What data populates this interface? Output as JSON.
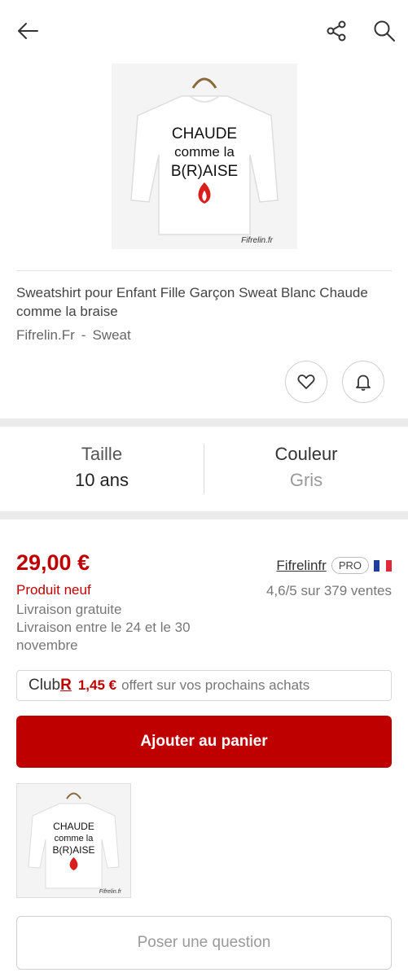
{
  "header": {
    "back_icon": "arrow-left-icon",
    "share_icon": "share-icon",
    "search_icon": "search-icon"
  },
  "product": {
    "image_text_line1": "CHAUDE",
    "image_text_line2": "comme la",
    "image_text_line3": "B(R)AISE",
    "image_watermark": "Fifrelin.fr",
    "title": "Sweatshirt pour Enfant Fille Garçon Sweat Blanc Chaude comme la braise",
    "brand": "Fifrelin.Fr",
    "brand_sep": "-",
    "category": "Sweat"
  },
  "actions": {
    "favorite_icon": "heart-icon",
    "alert_icon": "bell-icon"
  },
  "variants": {
    "size_label": "Taille",
    "size_value": "10 ans",
    "color_label": "Couleur",
    "color_value": "Gris"
  },
  "offer": {
    "price": "29,00 €",
    "condition": "Produit neuf",
    "shipping": "Livraison gratuite",
    "delivery": "Livraison entre le 24 et le 30 novembre",
    "seller_name": "Fifrelinfr",
    "seller_badge": "PRO",
    "seller_rating": "4,6/5 sur 379 ventes"
  },
  "club": {
    "logo_text": "Club",
    "logo_letter": "R",
    "amount": "1,45 €",
    "text": "offert sur vos prochains achats"
  },
  "cta": {
    "add_to_cart": "Ajouter au panier"
  },
  "question": {
    "label": "Poser une question"
  },
  "colors": {
    "accent": "#bf0000",
    "separator": "#ebebeb",
    "flag_blue": "#1f3fa0",
    "flag_white": "#ffffff",
    "flag_red": "#e0283a"
  }
}
